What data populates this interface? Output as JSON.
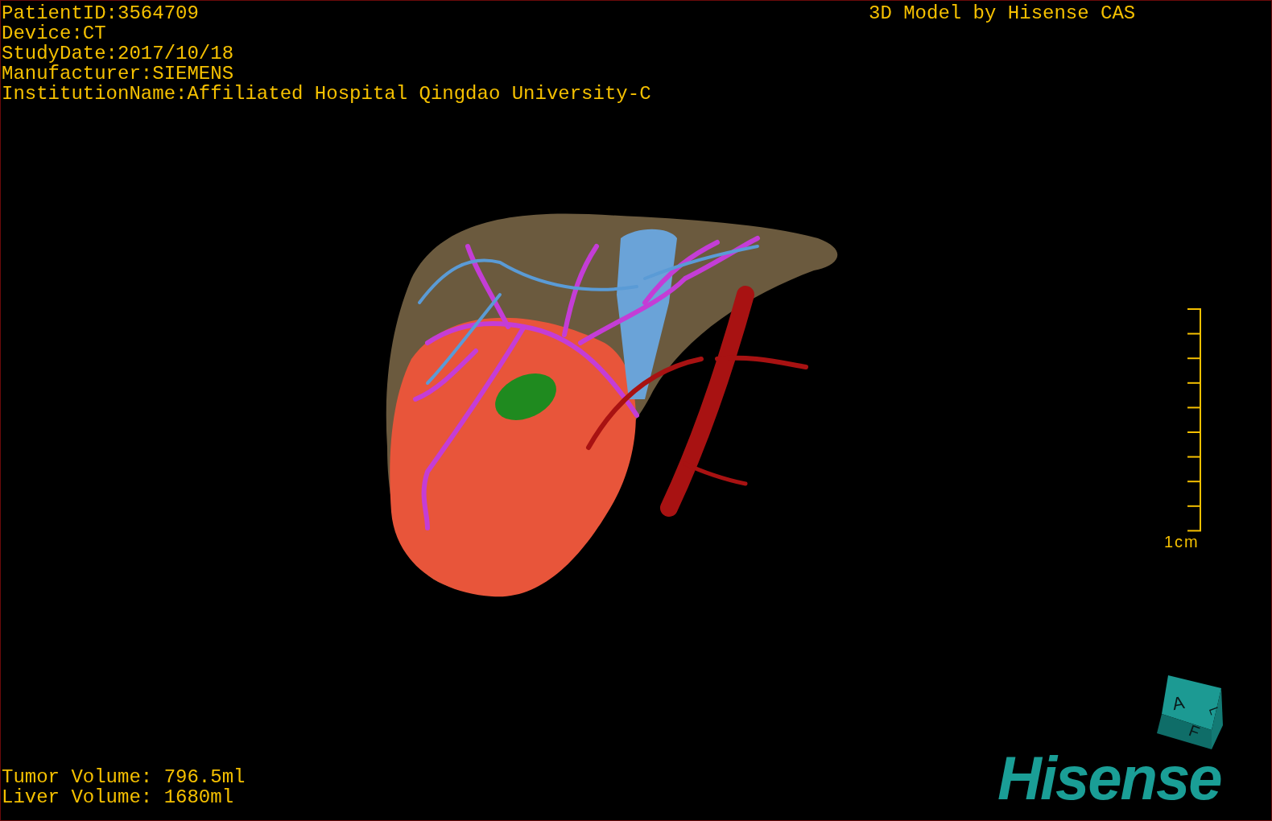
{
  "patient_info": [
    "PatientID:3564709",
    "Device:CT",
    "StudyDate:2017/10/18",
    "Manufacturer:SIEMENS",
    "InstitutionName:Affiliated Hospital Qingdao University-C"
  ],
  "title": "3D Model by Hisense CAS",
  "scale_bar": {
    "label": "1cm"
  },
  "orientation_cube": {
    "labels": [
      "A",
      "F",
      "L"
    ]
  },
  "volumes": [
    "Tumor Volume: 796.5ml",
    "Liver Volume: 1680ml"
  ],
  "logo": "Hisense"
}
